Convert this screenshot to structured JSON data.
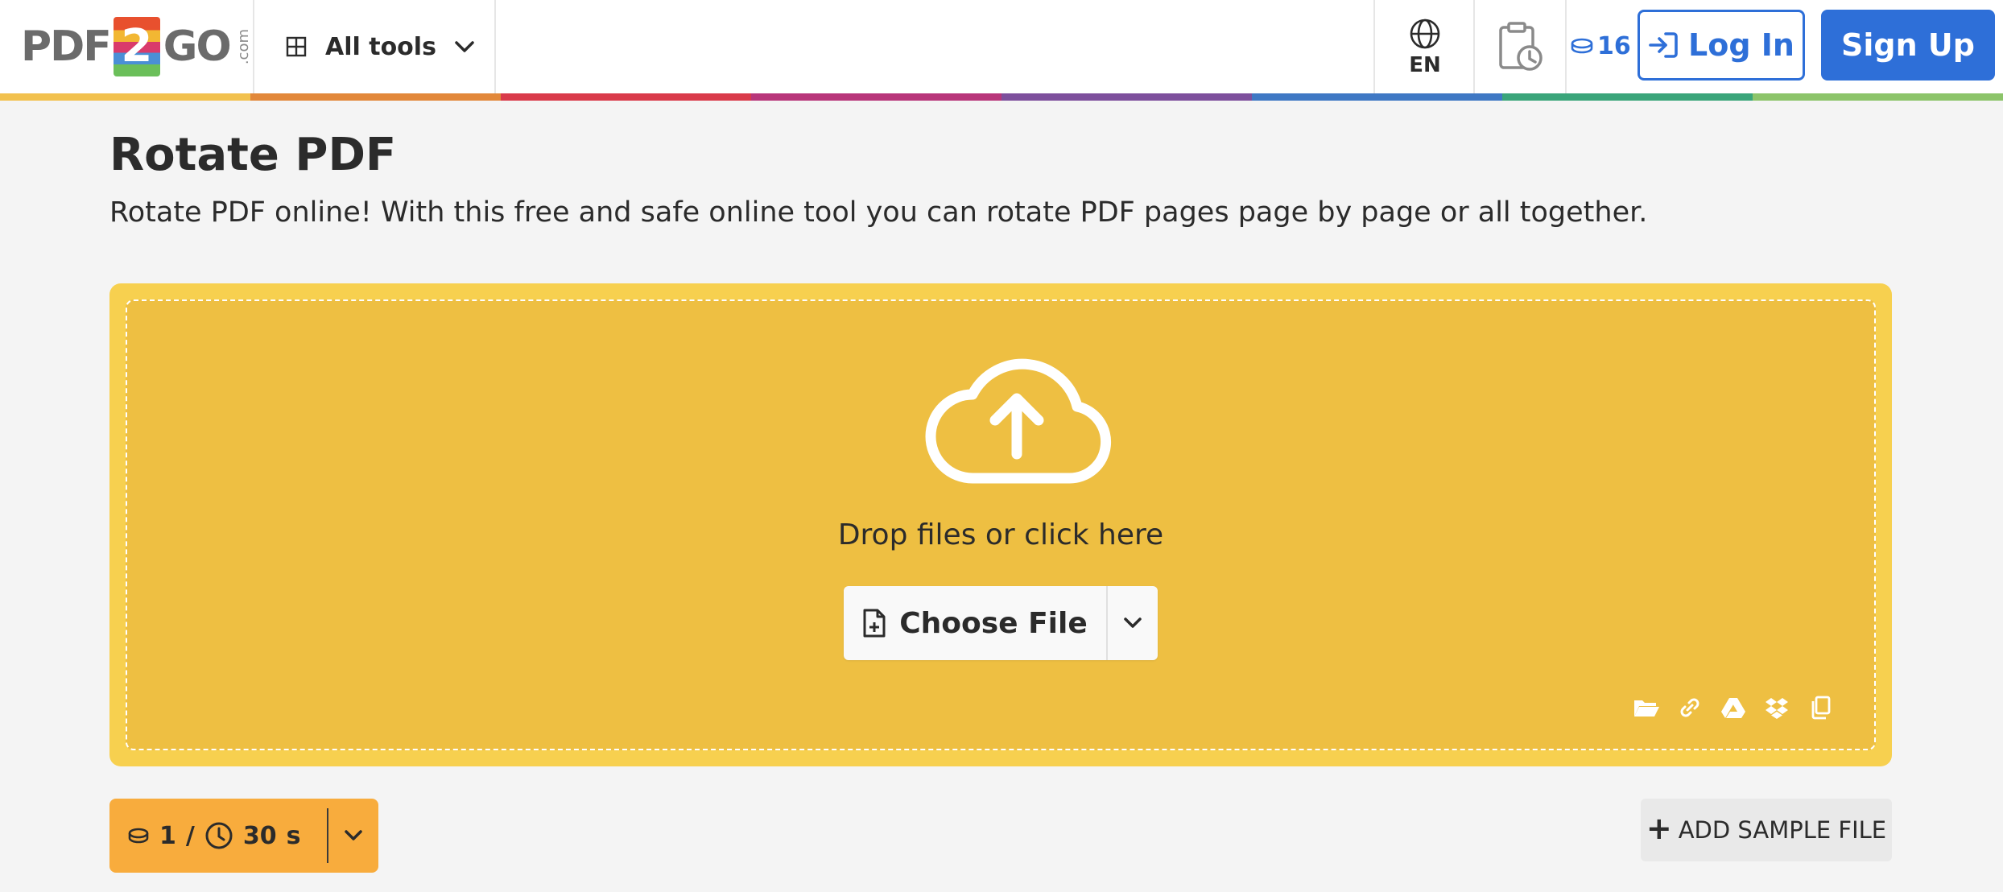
{
  "header": {
    "logo": {
      "left": "PDF",
      "middle": "2",
      "right": "GO",
      "suffix": ".com"
    },
    "all_tools_label": "All tools",
    "language_code": "EN",
    "credits": "16",
    "login_label": "Log In",
    "signup_label": "Sign Up"
  },
  "rainbow_colors": [
    "#f2c14e",
    "#e2883a",
    "#d93a4a",
    "#b8367a",
    "#7d4f9c",
    "#3f78c4",
    "#3aa57a",
    "#8cc46a"
  ],
  "main": {
    "title": "Rotate PDF",
    "description": "Rotate PDF online! With this free and safe online tool you can rotate PDF pages page by page or all together."
  },
  "dropzone": {
    "prompt": "Drop files or click here",
    "choose_file_label": "Choose File",
    "sources": [
      "folder-icon",
      "link-icon",
      "google-drive-icon",
      "dropbox-icon",
      "clipboard-icon"
    ]
  },
  "cost": {
    "credits": "1",
    "separator": "/",
    "time": "30",
    "unit": "s"
  },
  "sample_label": "ADD SAMPLE FILE",
  "colors": {
    "accent": "#2e6fd8",
    "dropzone": "#eebf42",
    "cost": "#f8ac3d"
  }
}
